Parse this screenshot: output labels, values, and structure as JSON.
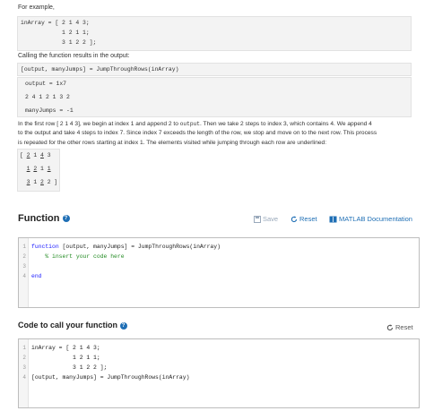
{
  "intro": {
    "for_example": "For example,"
  },
  "example_input": {
    "line1": "inArray = [ 2 1 4 3;",
    "line2": "            1 2 1 1;",
    "line3": "            3 1 2 2 ];"
  },
  "calling_text": "Calling the function results in the output:",
  "call_line": "[output, manyJumps] = JumpThroughRows(inArray)",
  "output": {
    "label": "output = 1x7",
    "values": "2 4 1 2 1 3 2",
    "jumps": "manyJumps = -1"
  },
  "explanation": {
    "line1a": "In the first row [ 2 1 4 3], we begin at index 1 and append 2 to ",
    "line1_code": "output",
    "line1b": ". Then we take 2 steps to index 3, which contains 4. We append 4",
    "line2": "to the output and take 4 steps to index 7. Since index 7 exceeds the length of the row, we stop and move on to the next row. This process",
    "line3": "is repeated for the other rows starting at index 1. The elements visited while jumping through each row are underlined:"
  },
  "underlined_matrix": {
    "row1": {
      "open": "[ ",
      "a": "2",
      "b": "1",
      "c": "4",
      "d": "3"
    },
    "row2": {
      "a": "1",
      "b": "2",
      "c": "1",
      "d": "1"
    },
    "row3": {
      "a": "3",
      "b": "1",
      "c": "2",
      "d": "2",
      "close": " ]"
    }
  },
  "function_section": {
    "title": "Function",
    "help": "?",
    "save_label": "Save",
    "reset_label": "Reset",
    "doc_label": "MATLAB Documentation",
    "lines": {
      "n1": "1",
      "n2": "2",
      "n3": "3",
      "n4": "4",
      "l1_kw": "function",
      "l1_rest": " [output, manyJumps] = JumpThroughRows(inArray)",
      "l2": "    % insert your code here",
      "l4": "end"
    }
  },
  "call_section": {
    "title": "Code to call your function",
    "help": "?",
    "reset_label": "Reset",
    "lines": {
      "n1": "1",
      "n2": "2",
      "n3": "3",
      "n4": "4",
      "l1": "inArray = [ 2 1 4 3;",
      "l2": "            1 2 1 1;",
      "l3": "            3 1 2 2 ];",
      "l4": "[output, manyJumps] = JumpThroughRows(inArray)"
    }
  },
  "colors": {
    "accent": "#1f6fb5",
    "save_disabled": "#9aa9bb",
    "code_bg": "#f3f3f3"
  }
}
